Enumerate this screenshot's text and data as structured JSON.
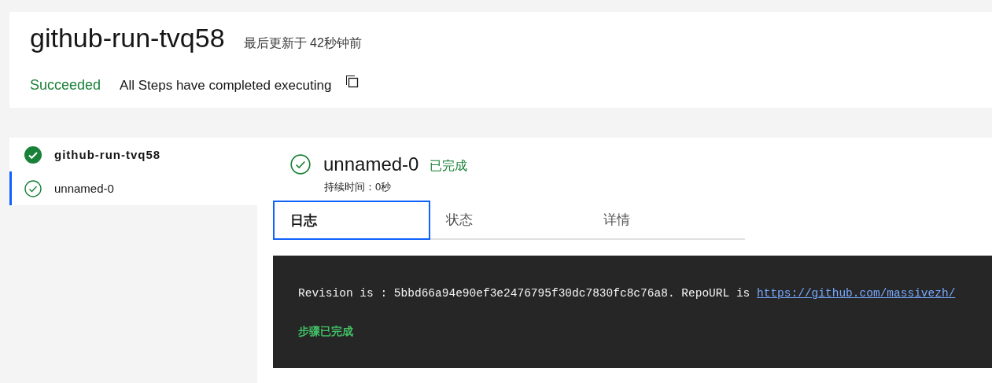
{
  "header": {
    "title": "github-run-tvq58",
    "updated": "最后更新于 42秒钟前",
    "status": "Succeeded",
    "message": "All Steps have completed executing"
  },
  "steps": [
    {
      "kind": "pipeline",
      "label": "github-run-tvq58",
      "selected": false
    },
    {
      "kind": "task",
      "label": "unnamed-0",
      "selected": true
    }
  ],
  "detail": {
    "title": "unnamed-0",
    "status": "已完成",
    "duration": "持续时间：0秒"
  },
  "tabs": [
    {
      "label": "日志",
      "selected": true
    },
    {
      "label": "状态",
      "selected": false
    },
    {
      "label": "详情",
      "selected": false
    }
  ],
  "log": {
    "line": "Revision is : 5bbd66a94e90ef3e2476795f30dc7830fc8c76a8. RepoURL is ",
    "link": "https://github.com/massivezh/",
    "done": "步骤已完成"
  }
}
